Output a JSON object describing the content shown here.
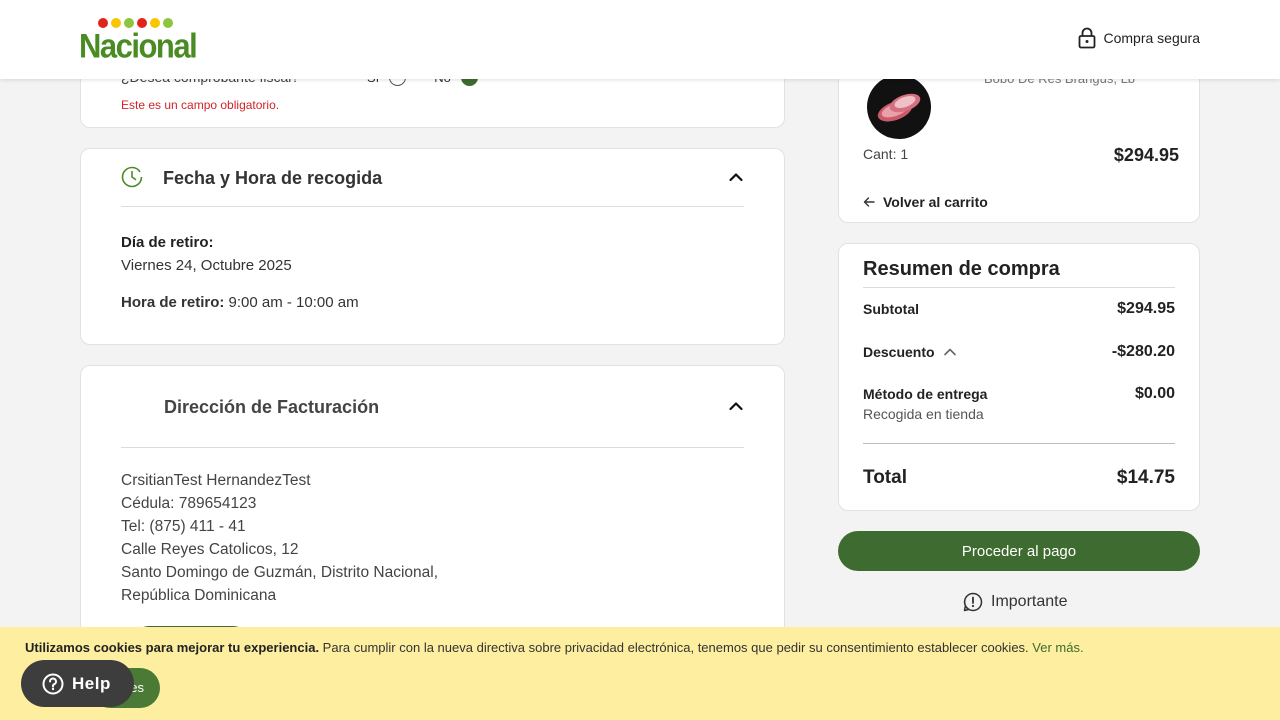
{
  "header": {
    "brand": "Nacional",
    "secure_label": "Compra segura"
  },
  "fiscal": {
    "question": "¿Desea comprobante fiscal?",
    "opt_yes": "Sí",
    "opt_no": "No",
    "error": "Este es un campo obligatorio."
  },
  "pickup": {
    "title": "Fecha y Hora de recogida",
    "day_label": "Día de retiro:",
    "day_value": "Viernes 24, Octubre 2025",
    "hour_label": "Hora de retiro:",
    "hour_value": "9:00 am - 10:00 am"
  },
  "billing": {
    "title": "Dirección de Facturación",
    "lines": [
      "CrsitianTest HernandezTest",
      "Cédula: 789654123",
      "Tel: (875) 411 - 41",
      "Calle Reyes Catolicos, 12",
      "Santo Domingo de Guzmán, Distrito Nacional,",
      "República Dominicana"
    ]
  },
  "cart_item": {
    "name": "Bobo De Res Brangus, Lb",
    "qty": "Cant: 1",
    "price": "$294.95",
    "back_label": "Volver al carrito"
  },
  "summary": {
    "title": "Resumen de compra",
    "subtotal_label": "Subtotal",
    "subtotal_value": "$294.95",
    "discount_label": "Descuento",
    "discount_value": "-$280.20",
    "delivery_label": "Método de entrega",
    "delivery_value": "$0.00",
    "delivery_method": "Recogida en tienda",
    "total_label": "Total",
    "total_value": "$14.75"
  },
  "actions": {
    "pay_label": "Proceder al pago",
    "important_label": "Importante"
  },
  "cookie": {
    "bold": "Utilizamos cookies para mejorar tu experiencia.",
    "text": " Para cumplir con la nueva directiva sobre privacidad electrónica, tenemos que pedir su consentimiento establecer cookies. ",
    "link": "Ver más.",
    "button_partial": "es"
  },
  "help_label": "Help",
  "colors": {
    "brand_green": "#3e6b2f",
    "logo_green": "#4a8b23",
    "error_red": "#d0242a",
    "cookie_bg": "#fdeea0"
  }
}
